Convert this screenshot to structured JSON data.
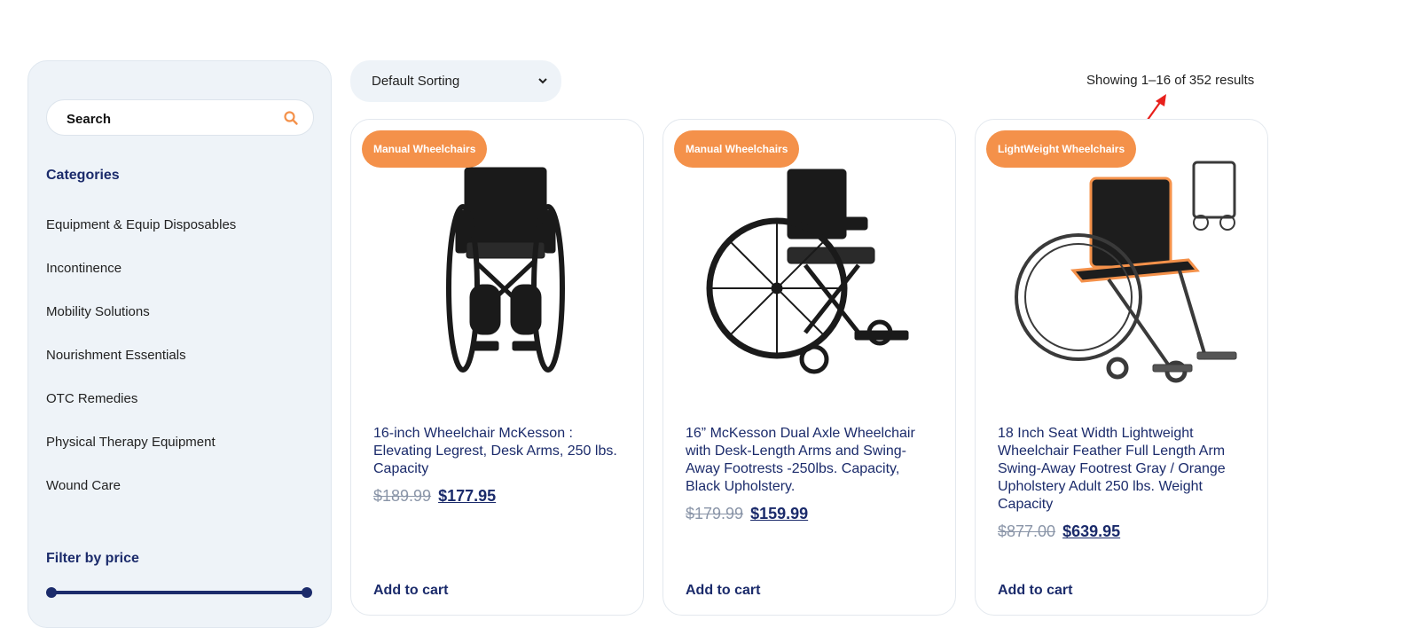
{
  "sidebar": {
    "search_placeholder": "Search",
    "categories_heading": "Categories",
    "categories": [
      "Equipment & Equip Disposables",
      "Incontinence",
      "Mobility Solutions",
      "Nourishment Essentials",
      "OTC Remedies",
      "Physical Therapy Equipment",
      "Wound Care"
    ],
    "filter_heading": "Filter by price",
    "price_range_fraction": [
      0,
      1
    ]
  },
  "toolbar": {
    "sort_selected": "Default Sorting",
    "result_count": "Showing 1–16 of 352 results"
  },
  "products": [
    {
      "badge": "Manual Wheelchairs",
      "title": "16-inch Wheelchair McKesson : Elevating Legrest, Desk Arms, 250 lbs. Capacity",
      "old_price": "$189.99",
      "new_price": "$177.95",
      "cart_label": "Add to cart"
    },
    {
      "badge": "Manual Wheelchairs",
      "title": "16” McKesson Dual Axle Wheelchair with Desk-Length Arms and Swing-Away Footrests -250lbs. Capacity, Black Upholstery.",
      "old_price": "$179.99",
      "new_price": "$159.99",
      "cart_label": "Add to cart"
    },
    {
      "badge": "LightWeight Wheelchairs",
      "title": "18 Inch Seat Width Lightweight Wheelchair Feather Full Length Arm Swing-Away Footrest Gray / Orange Upholstery Adult 250 lbs. Weight Capacity",
      "old_price": "$877.00",
      "new_price": "$639.95",
      "cart_label": "Add to cart"
    }
  ],
  "colors": {
    "accent_orange": "#f4914a",
    "brand_navy": "#1b2b6b",
    "sidebar_bg": "#eef3f8",
    "annotation_red": "#e8201c"
  }
}
